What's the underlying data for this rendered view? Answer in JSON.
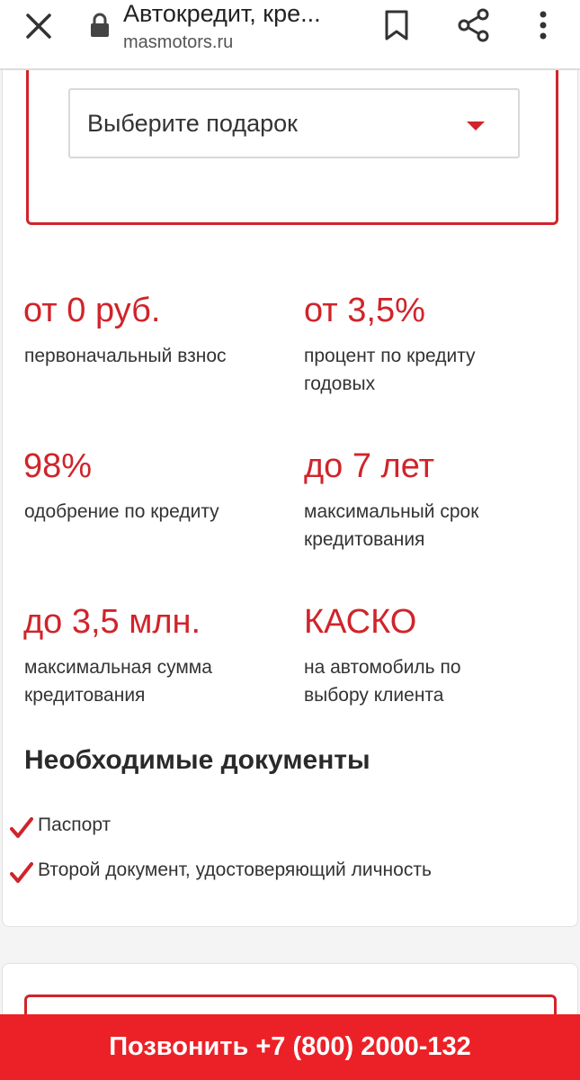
{
  "browser": {
    "title": "Автокредит, кре...",
    "url": "masmotors.ru"
  },
  "gift_select": {
    "placeholder": "Выберите подарок"
  },
  "stats": [
    {
      "value": "от 0 руб.",
      "desc": "первоначальный взнос"
    },
    {
      "value": "от 3,5%",
      "desc": "процент по кредиту годовых"
    },
    {
      "value": "98%",
      "desc": "одобрение по кредиту"
    },
    {
      "value": "до 7 лет",
      "desc": "максимальный срок кредитования"
    },
    {
      "value": "до 3,5 млн.",
      "desc": "максимальная сумма кредитования"
    },
    {
      "value": "КАСКО",
      "desc": "на автомобиль по выбору клиента"
    }
  ],
  "documents": {
    "title": "Необходимые документы",
    "items": [
      "Паспорт",
      "Второй документ, удостоверяющий личность"
    ]
  },
  "call_button": {
    "label": "Позвонить +7 (800) 2000-132"
  },
  "colors": {
    "accent": "#d0242b",
    "call_bar": "#ec2127"
  },
  "icons": [
    "close-icon",
    "lock-icon",
    "bookmark-icon",
    "share-icon",
    "more-icon",
    "caret-down-icon",
    "check-icon"
  ]
}
